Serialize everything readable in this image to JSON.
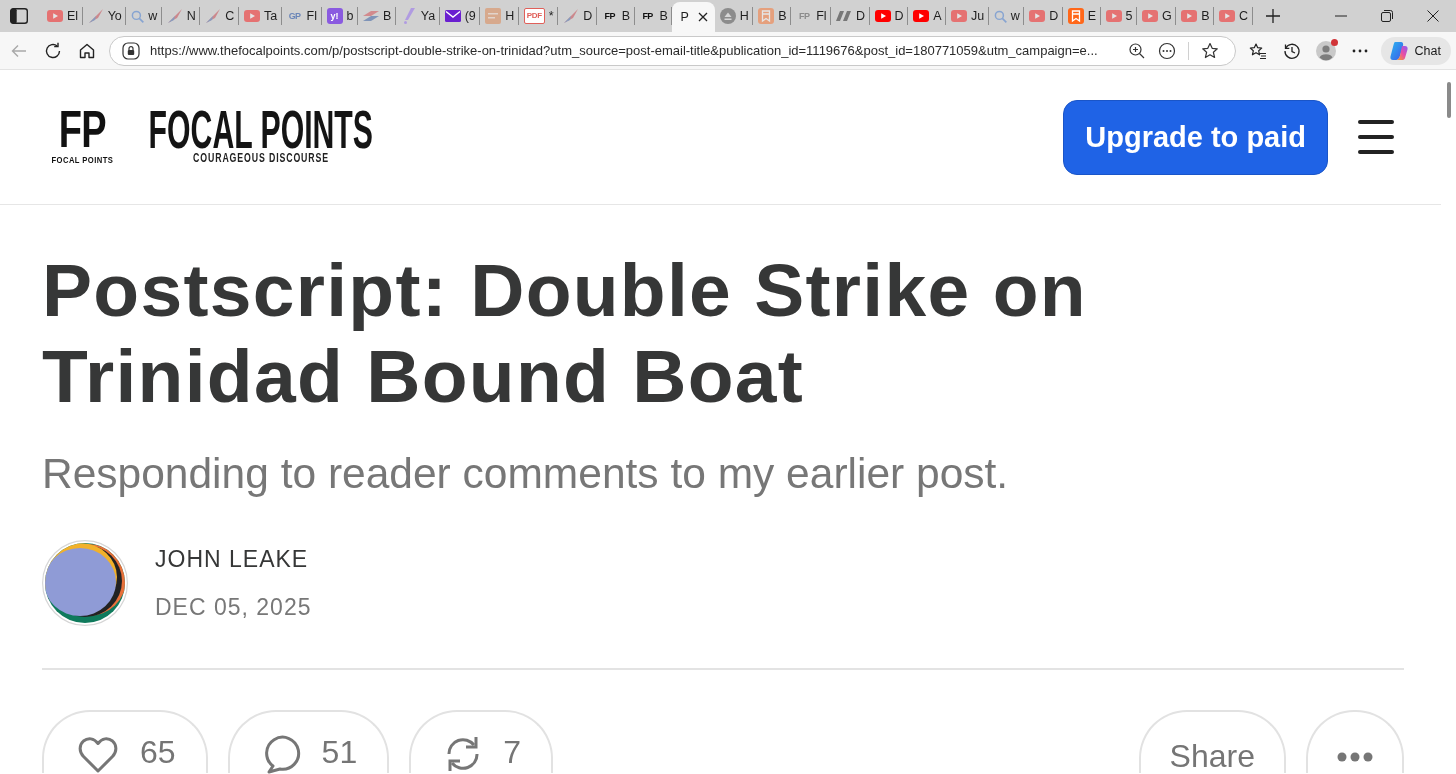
{
  "tabs": [
    {
      "kind": "video",
      "sleeping": true,
      "title": "El",
      "selected": false
    },
    {
      "kind": "bird",
      "sleeping": true,
      "title": "Yo",
      "selected": false
    },
    {
      "kind": "search",
      "sleeping": true,
      "title": "w",
      "selected": false
    },
    {
      "kind": "bird",
      "sleeping": true,
      "title": "N",
      "selected": false
    },
    {
      "kind": "bird",
      "sleeping": true,
      "title": "C",
      "selected": false
    },
    {
      "kind": "video",
      "sleeping": true,
      "title": "Ta",
      "selected": false
    },
    {
      "kind": "mono",
      "icon_text": "GP",
      "color": "#6b86b8",
      "sleeping": false,
      "title": "Fl",
      "selected": false
    },
    {
      "kind": "tile",
      "icon_text": "y!",
      "color": "#8a5ae0",
      "sleeping": false,
      "title": "b",
      "selected": false
    },
    {
      "kind": "flag",
      "sleeping": true,
      "title": "B",
      "selected": false
    },
    {
      "kind": "slash",
      "sleeping": true,
      "title": "Ya",
      "selected": false
    },
    {
      "kind": "mail",
      "sleeping": false,
      "title": "(9",
      "selected": false
    },
    {
      "kind": "image",
      "sleeping": true,
      "title": "H",
      "selected": false
    },
    {
      "kind": "pdf",
      "icon_text": "PDF",
      "color": "#e0605a",
      "sleeping": false,
      "title": "*",
      "selected": false
    },
    {
      "kind": "bird",
      "sleeping": true,
      "title": "D",
      "selected": false
    },
    {
      "kind": "mono",
      "icon_text": "FP",
      "color": "#111111",
      "sleeping": false,
      "title": "B",
      "selected": false
    },
    {
      "kind": "mono",
      "icon_text": "FP",
      "color": "#111111",
      "sleeping": false,
      "title": "B",
      "selected": false
    },
    {
      "title": "P",
      "selected": true
    },
    {
      "kind": "circle",
      "sleeping": false,
      "title": "H",
      "selected": false
    },
    {
      "kind": "bookmark",
      "sleeping": true,
      "title": "B",
      "selected": false
    },
    {
      "kind": "mono",
      "icon_text": "FP",
      "color": "#8c8c8c",
      "sleeping": false,
      "title": "Fl",
      "selected": false
    },
    {
      "kind": "slashes",
      "sleeping": false,
      "title": "D",
      "selected": false
    },
    {
      "kind": "video",
      "sleeping": false,
      "title": "D",
      "selected": false
    },
    {
      "kind": "video",
      "sleeping": false,
      "title": "A",
      "selected": false
    },
    {
      "kind": "video",
      "sleeping": true,
      "title": "Ju",
      "selected": false
    },
    {
      "kind": "search",
      "sleeping": true,
      "title": "w",
      "selected": false
    },
    {
      "kind": "video",
      "sleeping": true,
      "title": "D",
      "selected": false
    },
    {
      "kind": "bookmark",
      "sleeping": false,
      "title": "E",
      "selected": false
    },
    {
      "kind": "video",
      "sleeping": true,
      "title": "5",
      "selected": false
    },
    {
      "kind": "video",
      "sleeping": true,
      "title": "G",
      "selected": false
    },
    {
      "kind": "video",
      "sleeping": true,
      "title": "B",
      "selected": false
    },
    {
      "kind": "video",
      "sleeping": true,
      "title": "C",
      "selected": false
    }
  ],
  "toolbar": {
    "back": {
      "disabled": true
    },
    "address": "https://www.thefocalpoints.com/p/postscript-double-strike-on-trinidad?utm_source=post-email-title&publication_id=1119676&post_id=180771059&utm_campaign=e...",
    "profile": {
      "notification": true
    },
    "chat_button": "Chat"
  },
  "header": {
    "logo_mark": "FP",
    "logo_caption": "FOCAL POINTS",
    "site_name": "FOCAL POINTS",
    "tagline": "COURAGEOUS DISCOURSE",
    "upgrade_button": "Upgrade to paid"
  },
  "post": {
    "title": "Postscript: Double Strike on Trinidad Bound Boat",
    "subtitle": "Responding to reader comments to my earlier post.",
    "author": "JOHN LEAKE",
    "date": "DEC 05, 2025"
  },
  "actions": [
    {
      "kind": "like",
      "count": "65"
    },
    {
      "kind": "comment",
      "count": "51"
    },
    {
      "kind": "restack",
      "count": "7"
    },
    {
      "kind": "share",
      "label": "Share"
    },
    {
      "kind": "more"
    }
  ]
}
